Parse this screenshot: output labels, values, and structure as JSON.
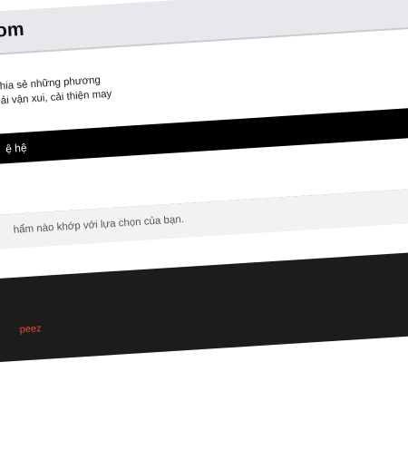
{
  "header": {
    "site_title": "om"
  },
  "intro": {
    "line1": "hia sẻ những phương",
    "line2": "ải vận xui, cải thiện may"
  },
  "nav": {
    "contact": "ệ hệ"
  },
  "search": {
    "placeholder": ""
  },
  "notice": {
    "text": "hẩm nào khớp với lựa chọn của bạn."
  },
  "footer": {
    "link": "peez"
  },
  "colors": {
    "accent_blue": "#2f6fa7",
    "footer_link": "#e24d2b",
    "sky": "#0d1e3a"
  }
}
